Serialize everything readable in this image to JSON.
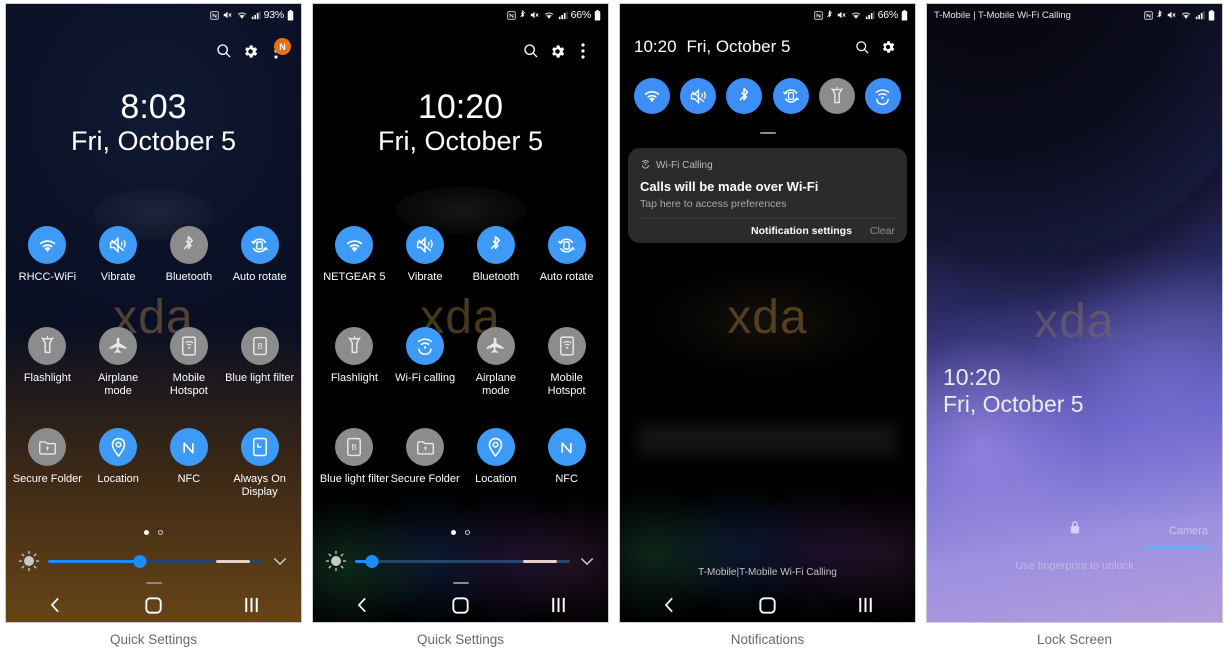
{
  "panels": [
    {
      "caption": "Quick Settings",
      "statusbar": {
        "carrier": "",
        "battery_text": "93%",
        "icons": [
          "nfc-icon",
          "mute-icon",
          "wifi-icon",
          "signal-icon",
          "battery-icon"
        ]
      },
      "header": {
        "search": "search-icon",
        "settings": "gear-icon",
        "overflow": "more-vert-icon",
        "badge": "N"
      },
      "clock": {
        "time": "8:03",
        "date": "Fri, October 5"
      },
      "tiles": [
        {
          "label": "RHCC-WiFi",
          "icon": "wifi-icon",
          "state": "on"
        },
        {
          "label": "Vibrate",
          "icon": "vibrate-icon",
          "state": "on"
        },
        {
          "label": "Bluetooth",
          "icon": "bluetooth-icon",
          "state": "off"
        },
        {
          "label": "Auto rotate",
          "icon": "auto-rotate-icon",
          "state": "on"
        },
        {
          "label": "Flashlight",
          "icon": "flashlight-icon",
          "state": "off"
        },
        {
          "label": "Airplane mode",
          "icon": "airplane-icon",
          "state": "off"
        },
        {
          "label": "Mobile Hotspot",
          "icon": "hotspot-icon",
          "state": "off"
        },
        {
          "label": "Blue light filter",
          "icon": "blue-light-icon",
          "state": "off"
        },
        {
          "label": "Secure Folder",
          "icon": "secure-folder-icon",
          "state": "off"
        },
        {
          "label": "Location",
          "icon": "location-icon",
          "state": "on"
        },
        {
          "label": "NFC",
          "icon": "nfc-icon",
          "state": "on"
        },
        {
          "label": "Always On Display",
          "icon": "always-on-display-icon",
          "state": "on"
        }
      ],
      "pages": {
        "count": 2,
        "active": 0
      },
      "brightness": {
        "value": 43
      },
      "watermark": "xda",
      "navbar": [
        "back-button",
        "home-button",
        "recents-button"
      ]
    },
    {
      "caption": "Quick Settings",
      "statusbar": {
        "carrier": "",
        "battery_text": "66%",
        "icons": [
          "nfc-icon",
          "bluetooth-icon",
          "mute-icon",
          "wifi-icon",
          "signal-icon",
          "battery-icon"
        ]
      },
      "header": {
        "search": "search-icon",
        "settings": "gear-icon",
        "overflow": "more-vert-icon",
        "badge": ""
      },
      "clock": {
        "time": "10:20",
        "date": "Fri, October 5"
      },
      "tiles": [
        {
          "label": "NETGEAR 5",
          "icon": "wifi-icon",
          "state": "on"
        },
        {
          "label": "Vibrate",
          "icon": "vibrate-icon",
          "state": "on"
        },
        {
          "label": "Bluetooth",
          "icon": "bluetooth-icon",
          "state": "on"
        },
        {
          "label": "Auto rotate",
          "icon": "auto-rotate-icon",
          "state": "on"
        },
        {
          "label": "Flashlight",
          "icon": "flashlight-icon",
          "state": "off"
        },
        {
          "label": "Wi-Fi calling",
          "icon": "wifi-calling-icon",
          "state": "on"
        },
        {
          "label": "Airplane mode",
          "icon": "airplane-icon",
          "state": "off"
        },
        {
          "label": "Mobile Hotspot",
          "icon": "hotspot-icon",
          "state": "off"
        },
        {
          "label": "Blue light filter",
          "icon": "blue-light-icon",
          "state": "off"
        },
        {
          "label": "Secure Folder",
          "icon": "secure-folder-icon",
          "state": "off"
        },
        {
          "label": "Location",
          "icon": "location-icon",
          "state": "on"
        },
        {
          "label": "NFC",
          "icon": "nfc-icon",
          "state": "on"
        }
      ],
      "pages": {
        "count": 2,
        "active": 0
      },
      "brightness": {
        "value": 8
      },
      "watermark": "xda",
      "navbar": [
        "back-button",
        "home-button",
        "recents-button"
      ]
    },
    {
      "caption": "Notifications",
      "statusbar": {
        "carrier": "",
        "battery_text": "66%",
        "icons": [
          "nfc-icon",
          "bluetooth-icon",
          "mute-icon",
          "wifi-icon",
          "signal-icon",
          "battery-icon"
        ]
      },
      "clock": {
        "time": "10:20",
        "date": "Fri, October 5"
      },
      "header": {
        "search": "search-icon",
        "settings": "gear-icon"
      },
      "mini_toggles": [
        {
          "icon": "wifi-icon",
          "state": "on"
        },
        {
          "icon": "vibrate-icon",
          "state": "on"
        },
        {
          "icon": "bluetooth-icon",
          "state": "on"
        },
        {
          "icon": "auto-rotate-icon",
          "state": "on"
        },
        {
          "icon": "flashlight-icon",
          "state": "off"
        },
        {
          "icon": "wifi-calling-icon",
          "state": "on"
        }
      ],
      "notification": {
        "app_icon": "wifi-calling-icon",
        "app_name": "Wi-Fi Calling",
        "title": "Calls will be made over Wi-Fi",
        "subtitle": "Tap here to access preferences",
        "settings_label": "Notification settings",
        "clear_label": "Clear"
      },
      "watermark": "xda",
      "carrier_footer": "T-Mobile|T-Mobile Wi-Fi Calling",
      "navbar": [
        "back-button",
        "home-button",
        "recents-button"
      ]
    },
    {
      "caption": "Lock Screen",
      "statusbar": {
        "carrier": "T-Mobile | T-Mobile Wi-Fi Calling",
        "battery_text": "",
        "icons": [
          "nfc-icon",
          "bluetooth-icon",
          "mute-icon",
          "wifi-icon",
          "signal-icon",
          "battery-icon"
        ]
      },
      "clock": {
        "time": "10:20",
        "date": "Fri, October 5"
      },
      "watermark": "xda",
      "lock_icon": "lock-icon",
      "hint": "Use fingerprint to unlock",
      "camera_label": "Camera"
    }
  ],
  "colors": {
    "accent_on": "#3d9bf7",
    "tile_off": "#8c8c8c",
    "badge": "#e8700f",
    "slider": "#1a8cff",
    "caption": "#6a6a6a"
  }
}
